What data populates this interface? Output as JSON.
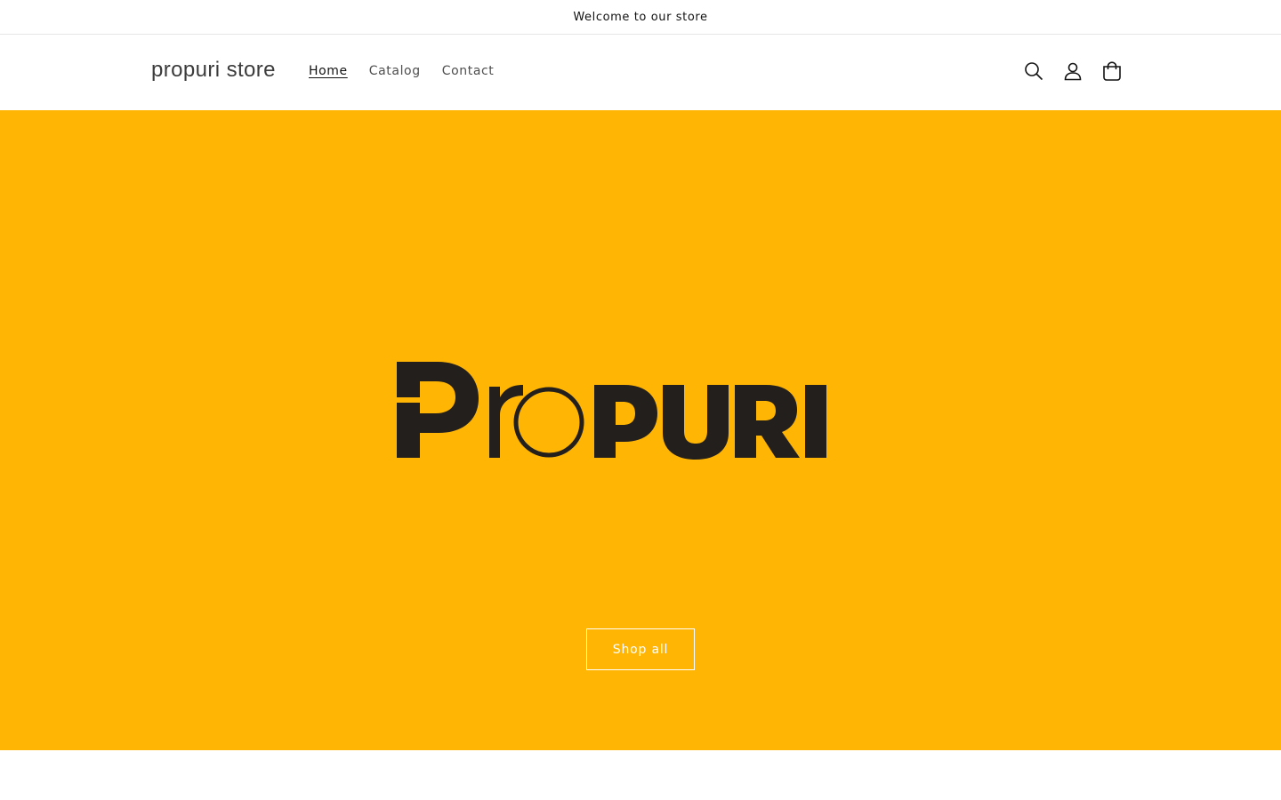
{
  "announcement": {
    "text": "Welcome to our store"
  },
  "header": {
    "store_name": "propuri store",
    "nav": [
      {
        "label": "Home",
        "active": true
      },
      {
        "label": "Catalog",
        "active": false
      },
      {
        "label": "Contact",
        "active": false
      }
    ],
    "icons": [
      "search-icon",
      "account-icon",
      "cart-icon"
    ]
  },
  "hero": {
    "background_color": "#ffb503",
    "logo_text": "ProPURI",
    "button_label": "Shop all"
  }
}
